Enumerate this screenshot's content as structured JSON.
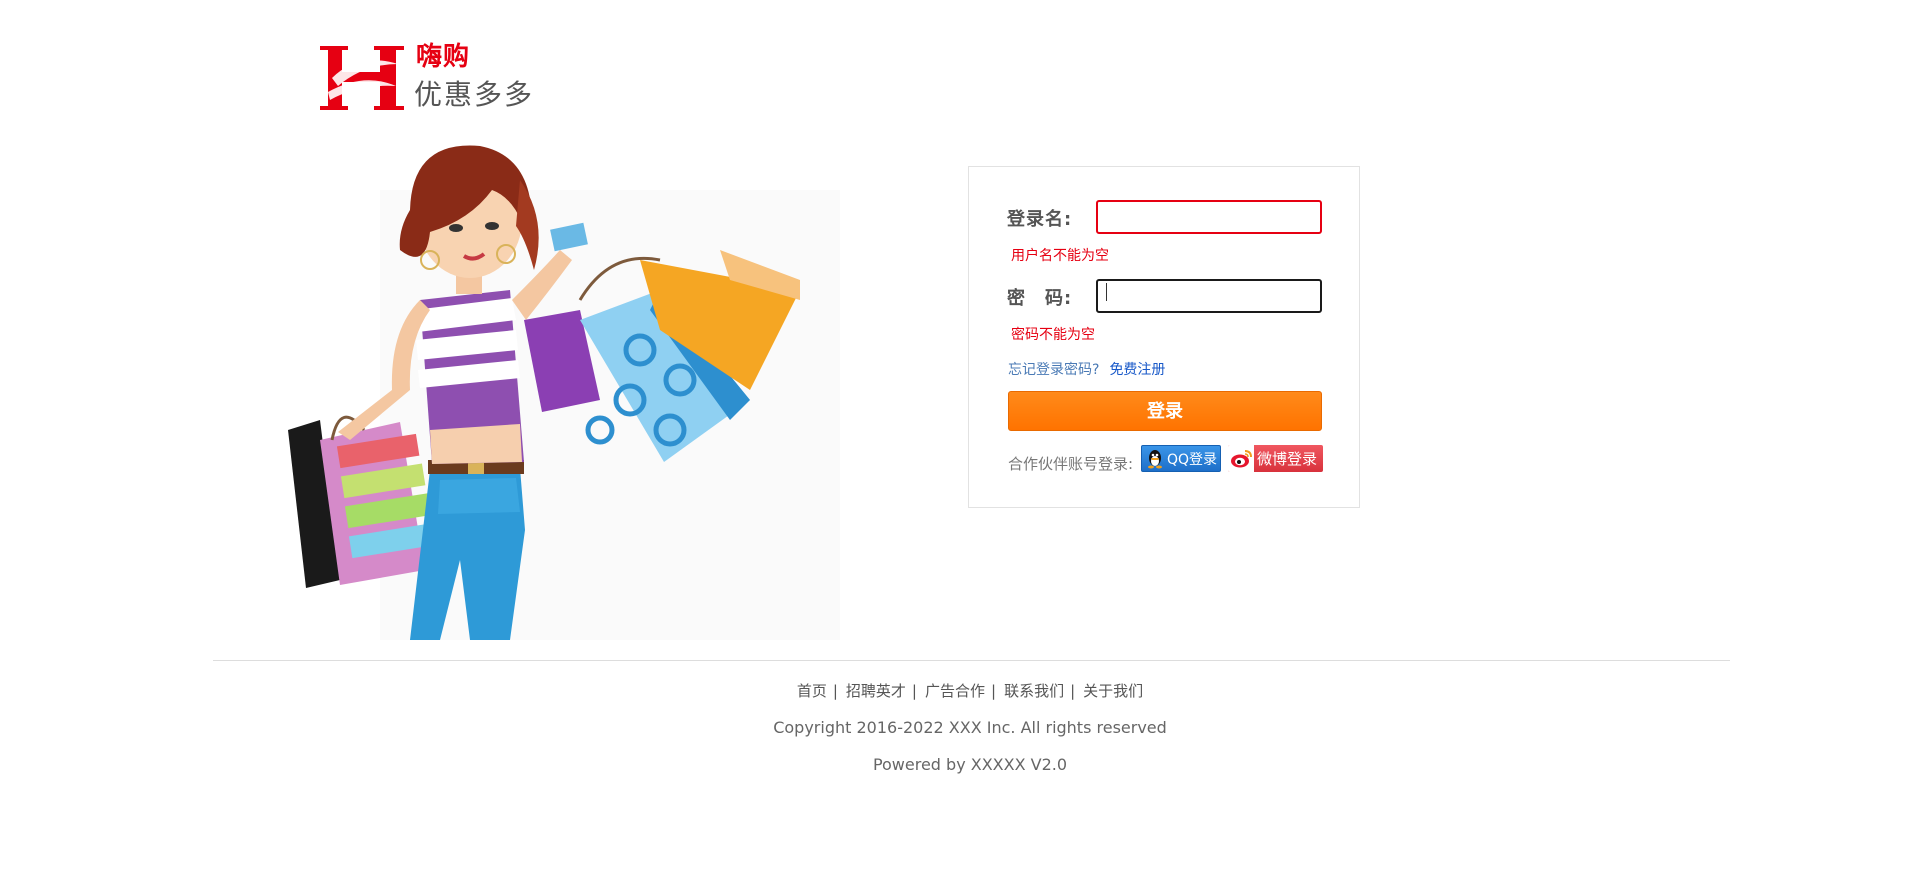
{
  "logo": {
    "letter": "H",
    "line1": "嗨购",
    "line2": "优惠多多",
    "brand_color": "#e60012"
  },
  "login": {
    "username_label": "登录名:",
    "username_value": "",
    "username_error": "用户名不能为空",
    "password_label": "密　码:",
    "password_value": "",
    "password_error": "密码不能为空",
    "forgot_link": "忘记登录密码?",
    "register_link": "免费注册",
    "submit_label": "登录",
    "partner_label": "合作伙伴账号登录:",
    "qq_label": "QQ登录",
    "weibo_label": "微博登录",
    "accent_color": "#ff7a0d",
    "error_color": "#e60012"
  },
  "footer": {
    "nav": [
      "首页",
      "招聘英才",
      "广告合作",
      "联系我们",
      "关于我们"
    ],
    "separator": "|",
    "copyright": "Copyright 2016-2022 XXX Inc. All rights reserved",
    "powered": "Powered by XXXXX V2.0"
  },
  "icons": {
    "hero": "shopping-woman-illustration",
    "qq": "qq-penguin-icon",
    "weibo": "weibo-eye-icon"
  }
}
